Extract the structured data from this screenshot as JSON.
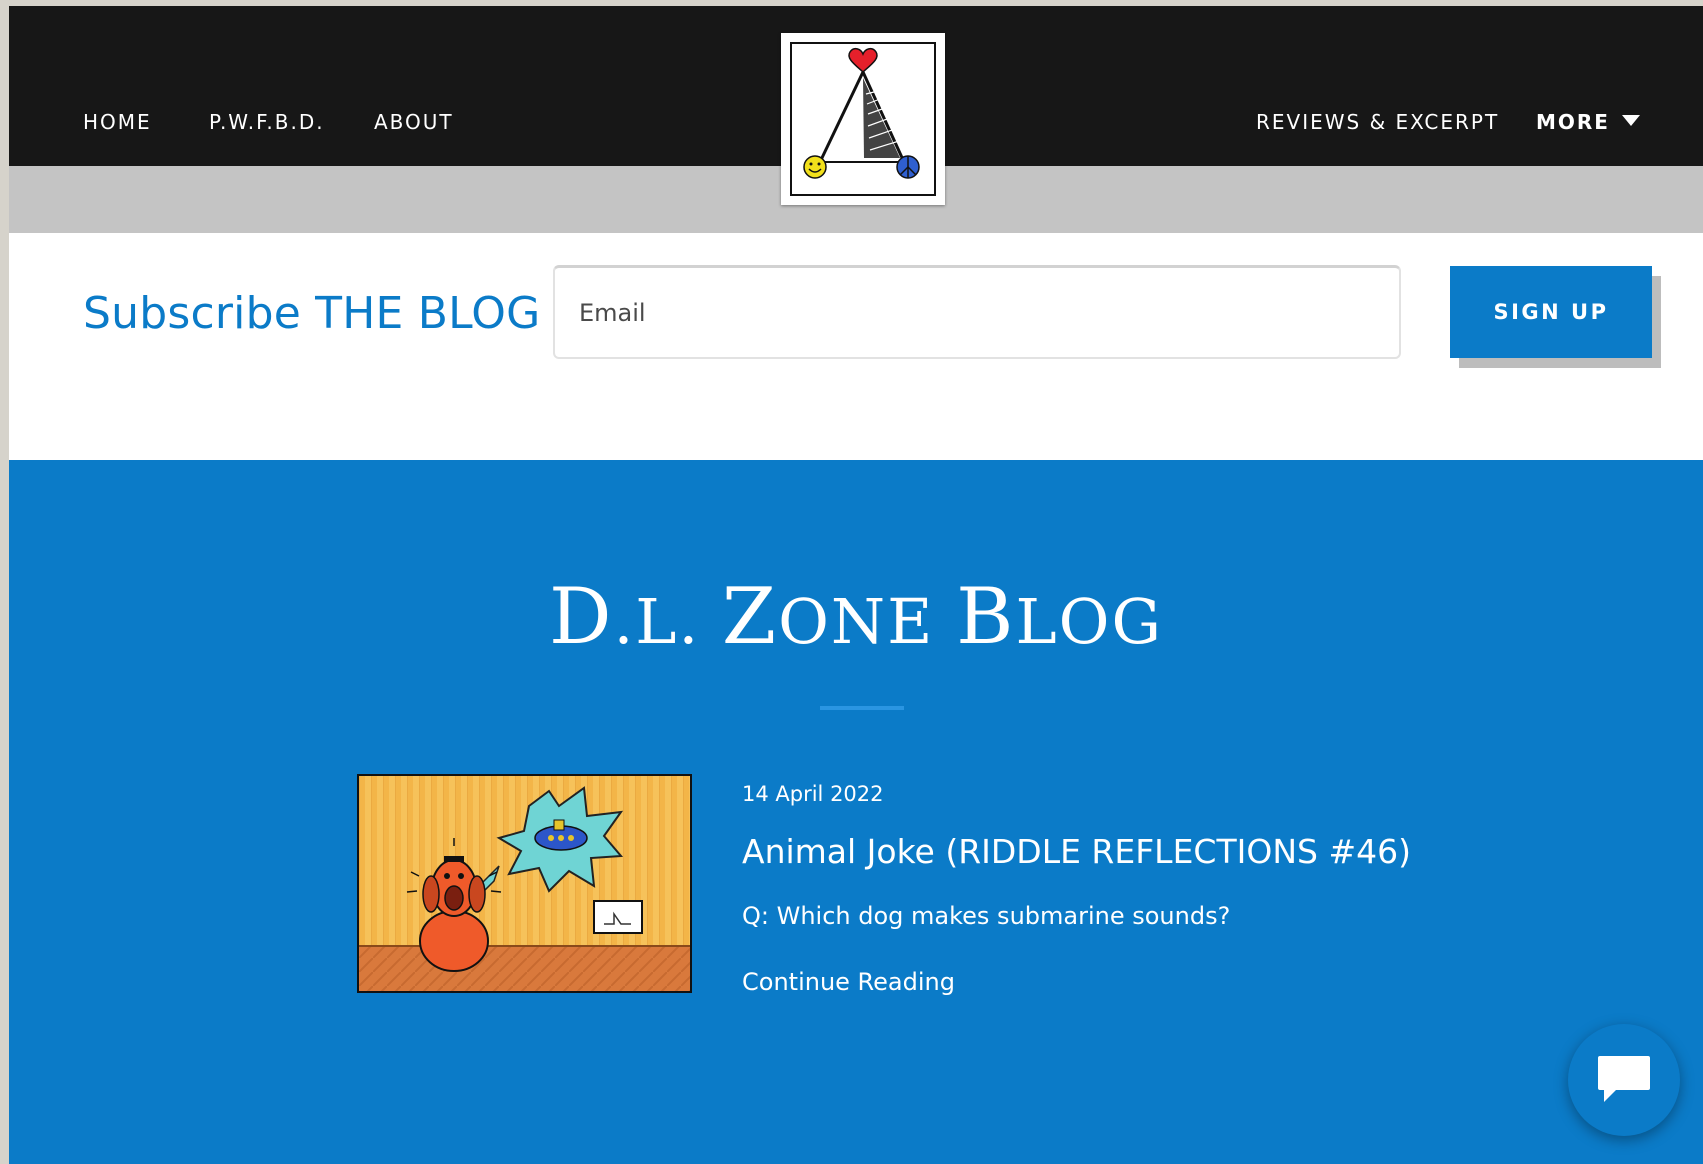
{
  "nav": {
    "left_items": [
      {
        "label": "HOME"
      },
      {
        "label": "P.W.F.B.D."
      },
      {
        "label": "ABOUT"
      }
    ],
    "right_items": [
      {
        "label": "REVIEWS & EXCERPT"
      },
      {
        "label": "MORE"
      }
    ],
    "more_icon": "caret-down-icon",
    "logo_icon": "triangle-heart-smiley-peace-logo"
  },
  "subscribe": {
    "title": "Subscribe THE BLOG",
    "email_placeholder": "Email",
    "button_label": "SIGN UP"
  },
  "blog": {
    "title_parts": [
      "D",
      ".L. ",
      "Z",
      "ONE ",
      "B",
      "LOG"
    ],
    "post": {
      "date": "14 April 2022",
      "title": "Animal Joke (RIDDLE REFLECTIONS #46)",
      "excerpt": "Q: Which dog makes submarine sounds?",
      "continue_label": "Continue Reading",
      "thumbnail_icon": "dog-submarine-cartoon"
    }
  },
  "chat": {
    "icon": "chat-bubble-icon"
  },
  "colors": {
    "accent": "#0b7bc8",
    "nav_bg": "#171717",
    "nav_sub_bg": "#c4c4c4",
    "divider": "#2a95e2"
  }
}
